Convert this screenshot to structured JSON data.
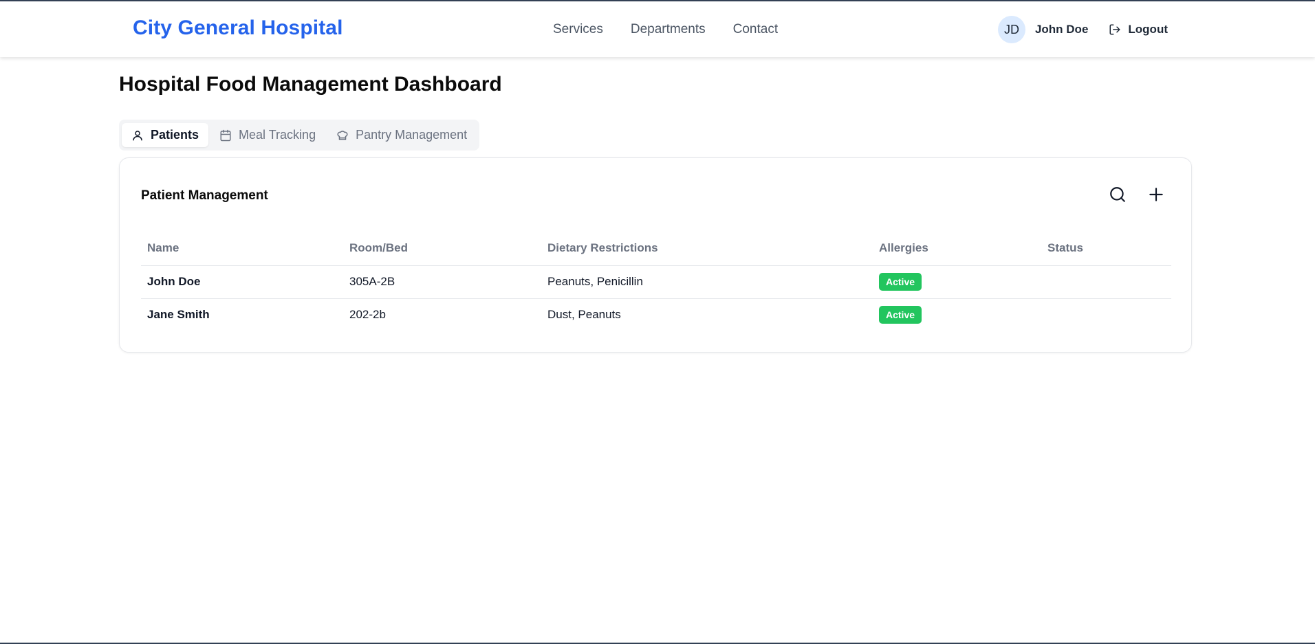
{
  "header": {
    "brand": "City General Hospital",
    "nav": [
      "Services",
      "Departments",
      "Contact"
    ],
    "user": {
      "initials": "JD",
      "name": "John Doe"
    },
    "logout_label": "Logout"
  },
  "page": {
    "title": "Hospital Food Management Dashboard"
  },
  "tabs": [
    {
      "label": "Patients",
      "icon": "user-icon",
      "active": true
    },
    {
      "label": "Meal Tracking",
      "icon": "calendar-icon",
      "active": false
    },
    {
      "label": "Pantry Management",
      "icon": "chef-hat-icon",
      "active": false
    }
  ],
  "panel": {
    "title": "Patient Management",
    "columns": [
      "Name",
      "Room/Bed",
      "Dietary Restrictions",
      "Allergies",
      "Status"
    ],
    "rows": [
      {
        "name": "John Doe",
        "room": "305A-2B",
        "dietary": "Peanuts, Penicillin",
        "badge": "Active"
      },
      {
        "name": "Jane Smith",
        "room": "202-2b",
        "dietary": "Dust, Peanuts",
        "badge": "Active"
      }
    ]
  },
  "colors": {
    "brand": "#2563eb",
    "badge": "#22c55e",
    "avatar_bg": "#dbeafe"
  }
}
